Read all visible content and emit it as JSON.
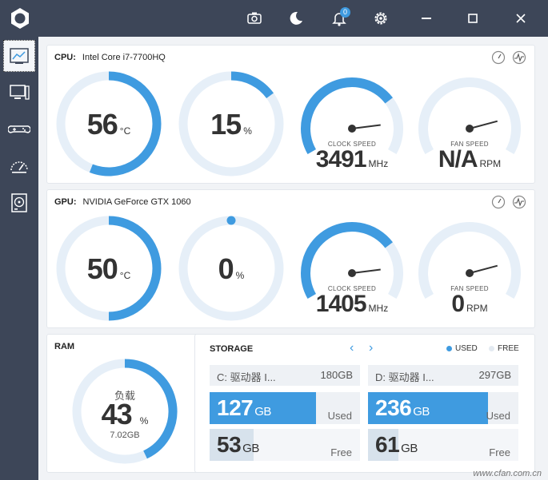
{
  "titlebar": {
    "notification_count": "0",
    "icons": [
      "screenshot-icon",
      "moon-icon",
      "bell-icon",
      "gear-icon",
      "minimize-icon",
      "maximize-icon",
      "close-icon"
    ]
  },
  "sidebar": {
    "items": [
      "dashboard-icon",
      "system-icon",
      "gamepad-icon",
      "speedometer-icon",
      "hard-drive-icon"
    ]
  },
  "cpu": {
    "label": "CPU:",
    "name": "Intel Core i7-7700HQ",
    "temp": "56",
    "temp_unit": "°C",
    "temp_fraction": 0.56,
    "usage": "15",
    "usage_unit": "%",
    "usage_fraction": 0.15,
    "clock_label": "CLOCK SPEED",
    "clock": "3491",
    "clock_unit": "MHz",
    "clock_fraction": 0.72,
    "fan_label": "FAN SPEED",
    "fan": "N/A",
    "fan_unit": "RPM",
    "fan_fraction": 0.0
  },
  "gpu": {
    "label": "GPU:",
    "name": "NVIDIA GeForce GTX 1060",
    "temp": "50",
    "temp_unit": "°C",
    "temp_fraction": 0.5,
    "usage": "0",
    "usage_unit": "%",
    "usage_fraction": 0.0,
    "clock_label": "CLOCK SPEED",
    "clock": "1405",
    "clock_unit": "MHz",
    "clock_fraction": 0.72,
    "fan_label": "FAN SPEED",
    "fan": "0",
    "fan_unit": "RPM",
    "fan_fraction": 0.0
  },
  "ram": {
    "title": "RAM",
    "caption": "负载",
    "usage": "43",
    "usage_unit": "%",
    "usage_fraction": 0.43,
    "amount": "7.02GB"
  },
  "storage": {
    "title": "STORAGE",
    "prev": "‹",
    "next": "›",
    "legend_used": "USED",
    "legend_free": "FREE",
    "drives": [
      {
        "name": "C: 驱动器 I...",
        "total": "180GB",
        "used": "127",
        "used_unit": "GB",
        "used_label": "Used",
        "free": "53",
        "free_unit": "GB",
        "free_label": "Free",
        "used_fraction": 0.71,
        "free_fraction": 0.29
      },
      {
        "name": "D: 驱动器 I...",
        "total": "297GB",
        "used": "236",
        "used_unit": "GB",
        "used_label": "Used",
        "free": "61",
        "free_unit": "GB",
        "free_label": "Free",
        "used_fraction": 0.8,
        "free_fraction": 0.2
      }
    ]
  },
  "watermark": "www.cfan.com.cn",
  "colors": {
    "accent": "#3f9be0",
    "track": "#e6eff8",
    "sidebar": "#3d4658"
  }
}
